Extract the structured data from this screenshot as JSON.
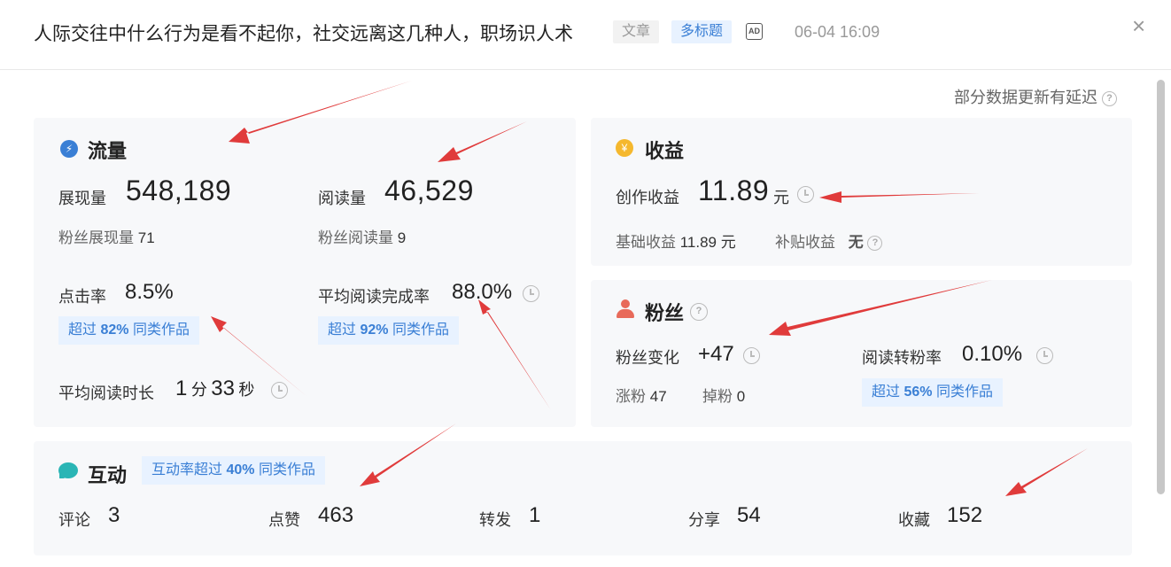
{
  "header": {
    "title": "人际交往中什么行为是看不起你，社交远离这几种人，职场识人术",
    "tag_article": "文章",
    "tag_multititle": "多标题",
    "ad_icon_text": "AD",
    "datetime": "06-04 16:09",
    "close_symbol": "×"
  },
  "delay_note": "部分数据更新有延迟",
  "traffic": {
    "title": "流量",
    "impressions_label": "展现量",
    "impressions_value": "548,189",
    "reads_label": "阅读量",
    "reads_value": "46,529",
    "fan_impressions_label": "粉丝展现量",
    "fan_impressions_value": "71",
    "fan_reads_label": "粉丝阅读量",
    "fan_reads_value": "9",
    "ctr_label": "点击率",
    "ctr_value": "8.5%",
    "ctr_badge_prefix": "超过",
    "ctr_badge_pct": "82%",
    "ctr_badge_suffix": "同类作品",
    "completion_label": "平均阅读完成率",
    "completion_value": "88.0%",
    "completion_badge_prefix": "超过",
    "completion_badge_pct": "92%",
    "completion_badge_suffix": "同类作品",
    "avg_time_label": "平均阅读时长",
    "avg_time_min": "1",
    "avg_time_min_unit": "分",
    "avg_time_sec": "33",
    "avg_time_sec_unit": "秒"
  },
  "revenue": {
    "title": "收益",
    "icon_symbol": "¥",
    "creation_label": "创作收益",
    "creation_value": "11.89",
    "creation_unit": "元",
    "base_label": "基础收益",
    "base_value": "11.89 元",
    "subsidy_label": "补贴收益",
    "subsidy_value": "无"
  },
  "fans": {
    "title": "粉丝",
    "change_label": "粉丝变化",
    "change_value": "+47",
    "conversion_label": "阅读转粉率",
    "conversion_value": "0.10%",
    "gain_label": "涨粉",
    "gain_value": "47",
    "loss_label": "掉粉",
    "loss_value": "0",
    "conv_badge_prefix": "超过",
    "conv_badge_pct": "56%",
    "conv_badge_suffix": "同类作品"
  },
  "interaction": {
    "title": "互动",
    "badge_prefix": "互动率超过",
    "badge_pct": "40%",
    "badge_suffix": "同类作品",
    "comments_label": "评论",
    "comments_value": "3",
    "likes_label": "点赞",
    "likes_value": "463",
    "reposts_label": "转发",
    "reposts_value": "1",
    "shares_label": "分享",
    "shares_value": "54",
    "favorites_label": "收藏",
    "favorites_value": "152"
  },
  "colors": {
    "accent_blue": "#3a7fd5",
    "badge_bg": "#e8f2ff",
    "card_bg": "#f7f8fa",
    "arrow_red": "#e03b3b",
    "revenue_icon": "#f5b82e",
    "fans_icon": "#e86a5a",
    "interaction_icon": "#2ab5b5"
  }
}
